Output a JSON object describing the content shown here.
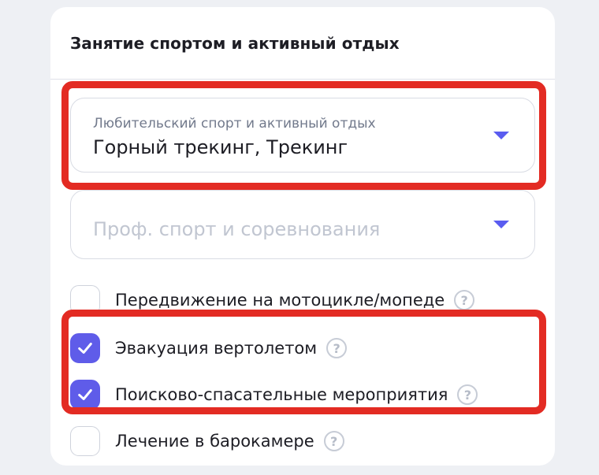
{
  "section": {
    "title": "Занятие спортом и активный отдых"
  },
  "amateur_select": {
    "label": "Любительский спорт и активный отдых",
    "value": "Горный трекинг, Трекинг"
  },
  "pro_select": {
    "placeholder": "Проф. спорт и соревнования"
  },
  "options": [
    {
      "label": "Передвижение на мотоцикле/мопеде",
      "checked": false
    },
    {
      "label": "Эвакуация вертолетом",
      "checked": true
    },
    {
      "label": "Поисково-спасательные мероприятия",
      "checked": true
    },
    {
      "label": "Лечение в барокамере",
      "checked": false
    }
  ],
  "help_symbol": "?",
  "colors": {
    "accent": "#5f5ce9",
    "highlight": "#e32b23"
  },
  "icons": {
    "dropdown": "caret-down-icon",
    "check": "check-icon",
    "help": "question-circle-icon"
  }
}
